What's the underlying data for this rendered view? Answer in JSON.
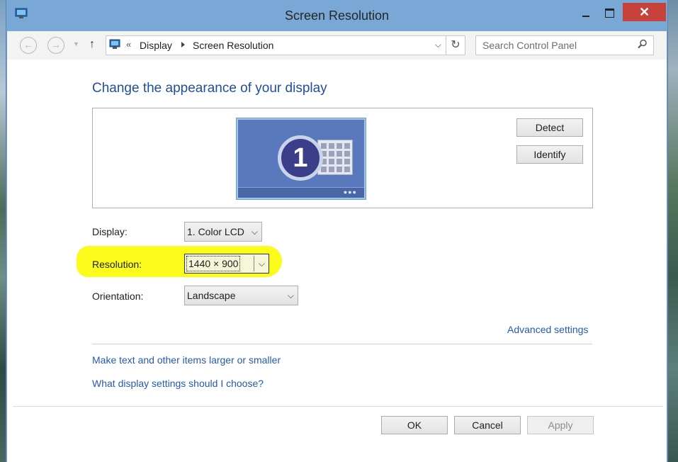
{
  "window": {
    "title": "Screen Resolution"
  },
  "nav": {
    "breadcrumb": [
      "Display",
      "Screen Resolution"
    ],
    "search_placeholder": "Search Control Panel"
  },
  "main": {
    "heading": "Change the appearance of your display",
    "monitor_number": "1",
    "detect_label": "Detect",
    "identify_label": "Identify",
    "display_label": "Display:",
    "display_value": "1. Color LCD",
    "resolution_label": "Resolution:",
    "resolution_value": "1440 × 900",
    "orientation_label": "Orientation:",
    "orientation_value": "Landscape",
    "advanced_link": "Advanced settings",
    "text_size_link": "Make text and other items larger or smaller",
    "help_link": "What display settings should I choose?"
  },
  "footer": {
    "ok_label": "OK",
    "cancel_label": "Cancel",
    "apply_label": "Apply"
  },
  "colors": {
    "accent": "#1f4e9c",
    "link": "#2459b3",
    "highlight": "#fbfb1c",
    "titlebar": "#7aa8d6",
    "close": "#c7423a"
  }
}
